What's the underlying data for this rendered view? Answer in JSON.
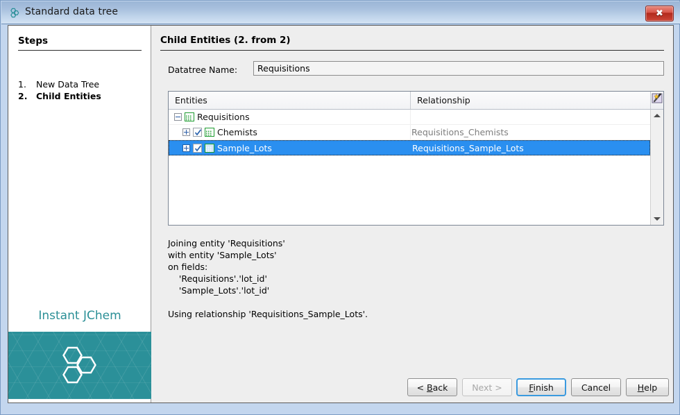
{
  "window": {
    "title": "Standard data tree",
    "title_icon": "jchem-hexagon-icon",
    "close_label": "✖"
  },
  "sidebar": {
    "heading": "Steps",
    "steps": [
      {
        "number": "1.",
        "label": "New Data Tree",
        "current": false
      },
      {
        "number": "2.",
        "label": "Child Entities",
        "current": true
      }
    ],
    "brand_name": "Instant JChem",
    "brand_logo_icon": "hexagon-cluster-logo"
  },
  "content": {
    "heading": "Child Entities (2. from 2)",
    "datatree_label": "Datatree Name:",
    "datatree_value": "Requisitions",
    "datatree_placeholder": "Datatree Name"
  },
  "table": {
    "columns": [
      "Entities",
      "Relationship"
    ],
    "corner_icon": "magic-wand-icon",
    "rows": [
      {
        "indent": 0,
        "expander": "minus",
        "has_checkbox": false,
        "checked": false,
        "icon": "entity-grid-icon",
        "entity": "Requisitions",
        "relationship": "",
        "selected": false
      },
      {
        "indent": 1,
        "expander": "plus",
        "has_checkbox": true,
        "checked": true,
        "icon": "entity-grid-icon",
        "entity": "Chemists",
        "relationship": "Requisitions_Chemists",
        "selected": false
      },
      {
        "indent": 1,
        "expander": "plus",
        "has_checkbox": true,
        "checked": true,
        "icon": "entity-grid-icon",
        "entity": "Sample_Lots",
        "relationship": "Requisitions_Sample_Lots",
        "selected": true
      }
    ],
    "scrollbar": {
      "up_icon": "scroll-up-arrow",
      "down_icon": "scroll-down-arrow"
    }
  },
  "description": "Joining entity 'Requisitions'\nwith entity 'Sample_Lots'\non fields:\n    'Requisitions'.'lot_id'\n    'Sample_Lots'.'lot_id'\n\nUsing relationship 'Requisitions_Sample_Lots'.",
  "footer": {
    "buttons": [
      {
        "id": "back",
        "text": "< Back",
        "mnemonic": "B",
        "state": "enabled"
      },
      {
        "id": "next",
        "text": "Next >",
        "mnemonic": "",
        "state": "disabled"
      },
      {
        "id": "finish",
        "text": "Finish",
        "mnemonic": "F",
        "state": "default"
      },
      {
        "id": "cancel",
        "text": "Cancel",
        "mnemonic": "",
        "state": "enabled"
      },
      {
        "id": "help",
        "text": "Help",
        "mnemonic": "H",
        "state": "enabled"
      }
    ]
  },
  "colors": {
    "brand_teal": "#2b9099",
    "selection_blue": "#2a8ff0",
    "titlebar_blue": "#a9c1de",
    "close_red": "#cc4436",
    "entity_icon_green": "#1d9b2f",
    "focus_border_blue": "#3a9adf"
  }
}
